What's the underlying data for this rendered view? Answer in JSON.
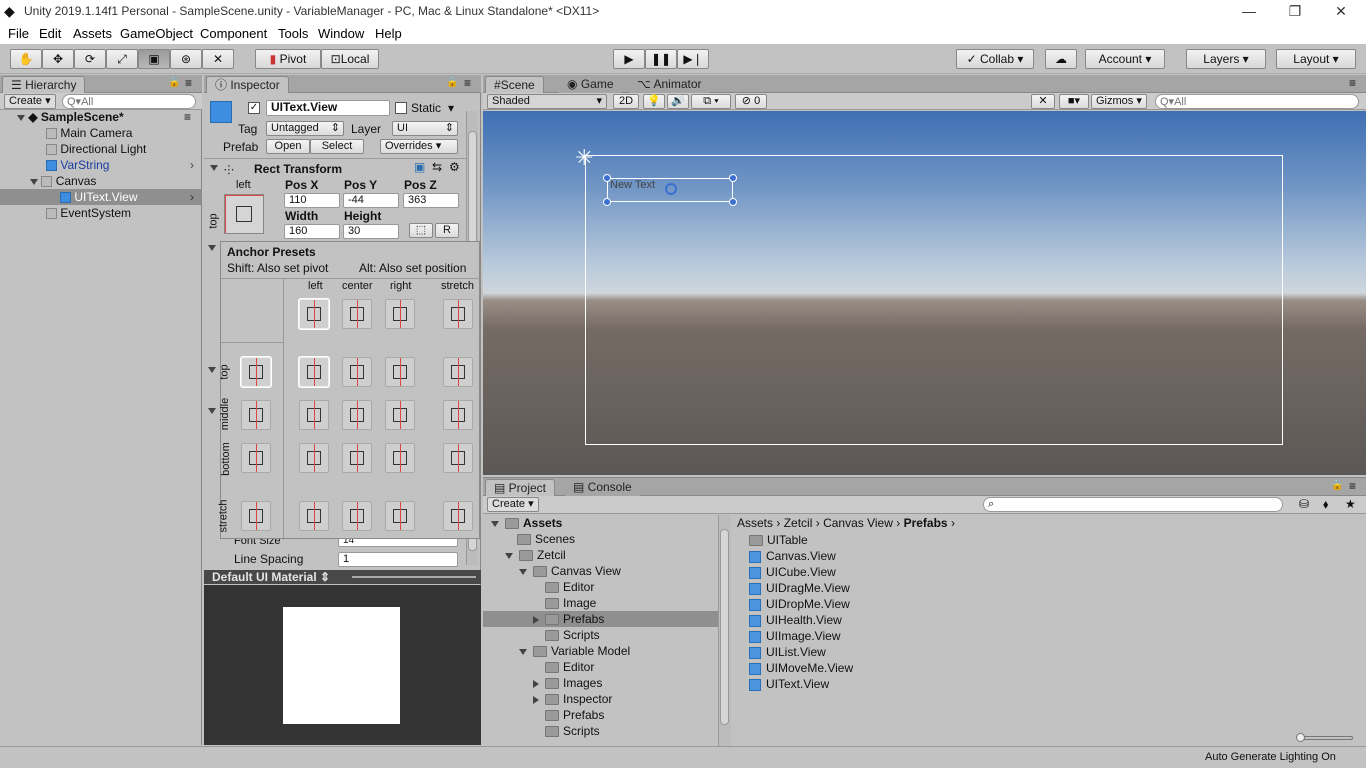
{
  "window": {
    "title": "Unity 2019.1.14f1 Personal - SampleScene.unity - VariableManager - PC, Mac & Linux Standalone* <DX11>"
  },
  "menu": [
    "File",
    "Edit",
    "Assets",
    "GameObject",
    "Component",
    "Tools",
    "Window",
    "Help"
  ],
  "toolbar": {
    "pivot": "Pivot",
    "local": "Local",
    "collab": "Collab",
    "account": "Account",
    "layers": "Layers",
    "layout": "Layout"
  },
  "hierarchy": {
    "tab": "Hierarchy",
    "create": "Create",
    "search_placeholder": "Q▾All",
    "scene": "SampleScene*",
    "items": [
      "Main Camera",
      "Directional Light",
      "VarString",
      "Canvas",
      "UIText.View",
      "EventSystem"
    ]
  },
  "inspector": {
    "tab": "Inspector",
    "object_name": "UIText.View",
    "static": "Static",
    "tag_label": "Tag",
    "tag_value": "Untagged",
    "layer_label": "Layer",
    "layer_value": "UI",
    "prefab_label": "Prefab",
    "open": "Open",
    "select": "Select",
    "overrides": "Overrides",
    "rect_transform": "Rect Transform",
    "anchor_h": "left",
    "anchor_v": "top",
    "posx_label": "Pos X",
    "posy_label": "Pos Y",
    "posz_label": "Pos Z",
    "posx": "110",
    "posy": "-44",
    "posz": "363",
    "width_label": "Width",
    "height_label": "Height",
    "width": "160",
    "height": "30",
    "r": "R",
    "font_size_label": "Font Size",
    "font_size": "14",
    "line_spacing_label": "Line Spacing",
    "line_spacing": "1",
    "material": "Default UI Material"
  },
  "anchor_presets": {
    "title": "Anchor Presets",
    "shift": "Shift: Also set pivot",
    "alt": "Alt: Also set position",
    "cols": [
      "left",
      "center",
      "right",
      "stretch"
    ],
    "rows": [
      "top",
      "middle",
      "bottom",
      "stretch"
    ]
  },
  "scene": {
    "tabs": [
      "Scene",
      "Game",
      "Animator"
    ],
    "shading": "Shaded",
    "mode2d": "2D",
    "hidden_count": "0",
    "gizmos": "Gizmos",
    "search_placeholder": "Q▾All",
    "ui_text": "New Text"
  },
  "project": {
    "tabs": [
      "Project",
      "Console"
    ],
    "create": "Create",
    "breadcrumb": [
      "Assets",
      "Zetcil",
      "Canvas View",
      "Prefabs"
    ],
    "tree": [
      {
        "label": "Assets",
        "depth": 0,
        "bold": true
      },
      {
        "label": "Scenes",
        "depth": 1
      },
      {
        "label": "Zetcil",
        "depth": 1
      },
      {
        "label": "Canvas View",
        "depth": 2
      },
      {
        "label": "Editor",
        "depth": 3
      },
      {
        "label": "Image",
        "depth": 3
      },
      {
        "label": "Prefabs",
        "depth": 3,
        "selected": true
      },
      {
        "label": "Scripts",
        "depth": 3
      },
      {
        "label": "Variable Model",
        "depth": 2
      },
      {
        "label": "Editor",
        "depth": 3
      },
      {
        "label": "Images",
        "depth": 3
      },
      {
        "label": "Inspector",
        "depth": 3
      },
      {
        "label": "Prefabs",
        "depth": 3
      },
      {
        "label": "Scripts",
        "depth": 3
      }
    ],
    "files": [
      "UITable",
      "Canvas.View",
      "UICube.View",
      "UIDragMe.View",
      "UIDropMe.View",
      "UIHealth.View",
      "UIImage.View",
      "UIList.View",
      "UIMoveMe.View",
      "UIText.View"
    ]
  },
  "status": {
    "text": "Auto Generate Lighting On"
  }
}
